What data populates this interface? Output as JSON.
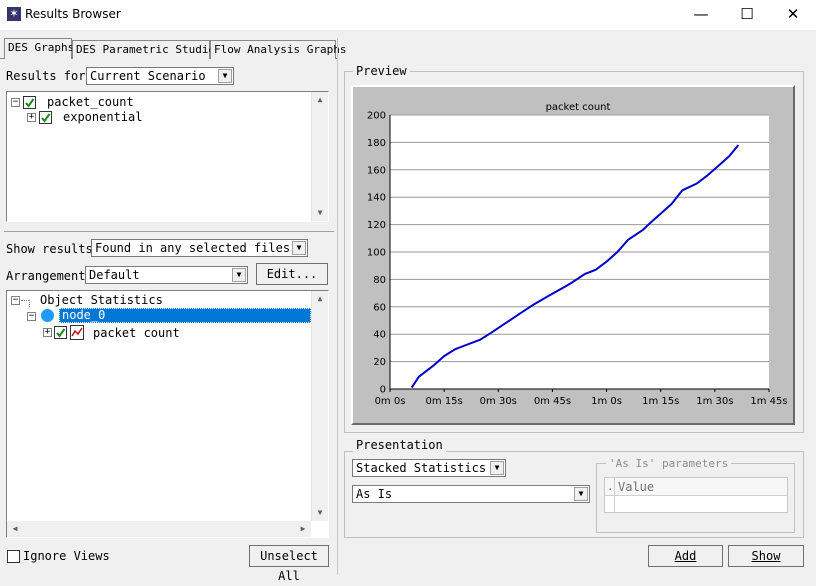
{
  "window": {
    "title": "Results Browser",
    "minimize": "—",
    "maximize": "☐",
    "close": "✕"
  },
  "tabs": [
    {
      "label": "DES Graphs",
      "active": true
    },
    {
      "label": "DES Parametric Studies",
      "active": false
    },
    {
      "label": "Flow Analysis Graphs",
      "active": false
    }
  ],
  "results_for": {
    "label": "Results for:",
    "value": "Current Scenario"
  },
  "results_tree": [
    {
      "label": "packet_count",
      "checked": true,
      "expanded": true
    },
    {
      "label": "exponential",
      "checked": true,
      "expanded": false
    }
  ],
  "show_results": {
    "label": "Show results:",
    "value": "Found in any selected files"
  },
  "arrangement": {
    "label": "Arrangement:",
    "value": "Default",
    "edit_label": "Edit..."
  },
  "stats_tree": {
    "root": "Object Statistics",
    "node": "node_0",
    "stat": "packet count"
  },
  "ignore_views": {
    "label": "Ignore Views",
    "checked": false
  },
  "unselect_all": "Unselect All",
  "preview": {
    "label": "Preview"
  },
  "presentation": {
    "label": "Presentation",
    "mode": "Stacked Statistics",
    "filter": "As Is",
    "params_label": "'As Is' parameters",
    "params_header": "Value",
    "params_dot": "."
  },
  "buttons": {
    "add": "Add",
    "show": "Show"
  },
  "chart_data": {
    "type": "line",
    "title": "packet count",
    "xlabel": "",
    "ylabel": "",
    "x_unit": "seconds",
    "xlim": [
      0,
      105
    ],
    "ylim": [
      0,
      200
    ],
    "x_ticks": [
      {
        "v": 0,
        "label": "0m 0s"
      },
      {
        "v": 15,
        "label": "0m 15s"
      },
      {
        "v": 30,
        "label": "0m 30s"
      },
      {
        "v": 45,
        "label": "0m 45s"
      },
      {
        "v": 60,
        "label": "1m 0s"
      },
      {
        "v": 75,
        "label": "1m 15s"
      },
      {
        "v": 90,
        "label": "1m 30s"
      },
      {
        "v": 105,
        "label": "1m 45s"
      }
    ],
    "y_ticks": [
      0,
      20,
      40,
      60,
      80,
      100,
      120,
      140,
      160,
      180,
      200
    ],
    "grid": true,
    "line_color": "#0000cc",
    "series": [
      {
        "x": [
          6,
          8,
          10,
          12,
          15,
          18,
          20,
          25,
          28,
          32,
          36,
          40,
          44,
          48,
          50,
          54,
          57,
          60,
          63,
          66,
          70,
          72,
          75,
          78,
          81,
          85,
          88,
          91,
          94,
          96.5
        ],
        "y": [
          1,
          9,
          13,
          17,
          24,
          29,
          31,
          36,
          41,
          48,
          55,
          62,
          68,
          74,
          77,
          84,
          87,
          93,
          100,
          109,
          116,
          121,
          128,
          135,
          145,
          150,
          156,
          163,
          170,
          178
        ]
      }
    ]
  }
}
